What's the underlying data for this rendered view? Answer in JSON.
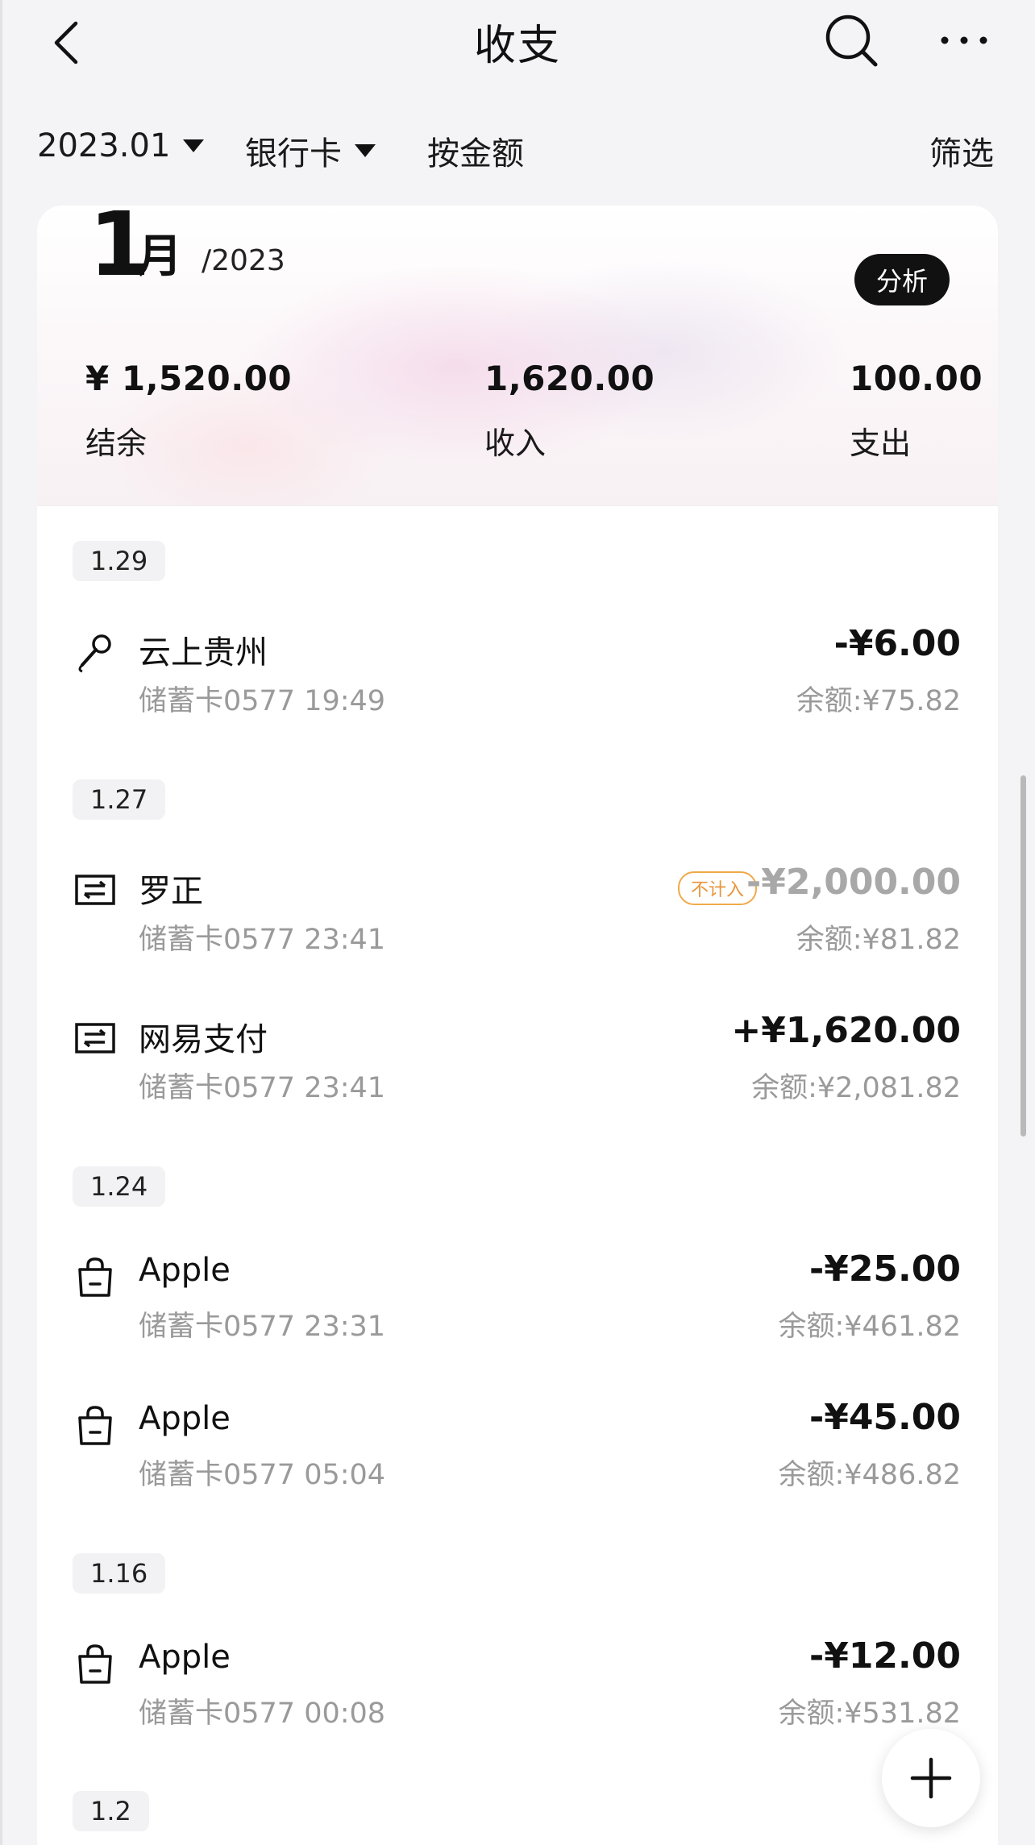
{
  "nav": {
    "title": "收支",
    "icons": {
      "back": "chevron-left-icon",
      "search": "search-icon",
      "more": "more-horizontal-icon"
    }
  },
  "filters": {
    "month": "2023.01",
    "card": "银行卡",
    "sort": "按金额",
    "filter": "筛选"
  },
  "summary": {
    "month": "1",
    "month_unit": "月",
    "year": "/2023",
    "analyze_label": "分析",
    "balance_value": "¥ 1,520.00",
    "balance_label": "结余",
    "income_value": "1,620.00",
    "income_label": "收入",
    "expense_value": "100.00",
    "expense_label": "支出"
  },
  "groups": [
    {
      "date": "1.29",
      "items": [
        {
          "icon": "microphone-icon",
          "name": "云上贵州",
          "sub": "储蓄卡0577 19:49",
          "amount": "-¥6.00",
          "balance": "余额:¥75.82"
        }
      ]
    },
    {
      "date": "1.27",
      "items": [
        {
          "icon": "transfer-icon",
          "name": "罗正",
          "sub": "储蓄卡0577 23:41",
          "amount": "-¥2,000.00",
          "balance": "余额:¥81.82",
          "badge": "不计入",
          "muted": true
        },
        {
          "icon": "transfer-icon",
          "name": "网易支付",
          "sub": "储蓄卡0577 23:41",
          "amount": "+¥1,620.00",
          "balance": "余额:¥2,081.82"
        }
      ]
    },
    {
      "date": "1.24",
      "items": [
        {
          "icon": "shopping-bag-icon",
          "name": "Apple",
          "sub": "储蓄卡0577 23:31",
          "amount": "-¥25.00",
          "balance": "余额:¥461.82"
        },
        {
          "icon": "shopping-bag-icon",
          "name": "Apple",
          "sub": "储蓄卡0577 05:04",
          "amount": "-¥45.00",
          "balance": "余额:¥486.82"
        }
      ]
    },
    {
      "date": "1.16",
      "items": [
        {
          "icon": "shopping-bag-icon",
          "name": "Apple",
          "sub": "储蓄卡0577 00:08",
          "amount": "-¥12.00",
          "balance": "余额:¥531.82"
        }
      ]
    },
    {
      "date": "1.2",
      "items": []
    }
  ],
  "fab": {
    "icon": "plus-icon"
  },
  "colors": {
    "accent": "#111111",
    "muted": "#9a9a9a",
    "badge": "#e8943a",
    "background": "#f4f4f6"
  }
}
